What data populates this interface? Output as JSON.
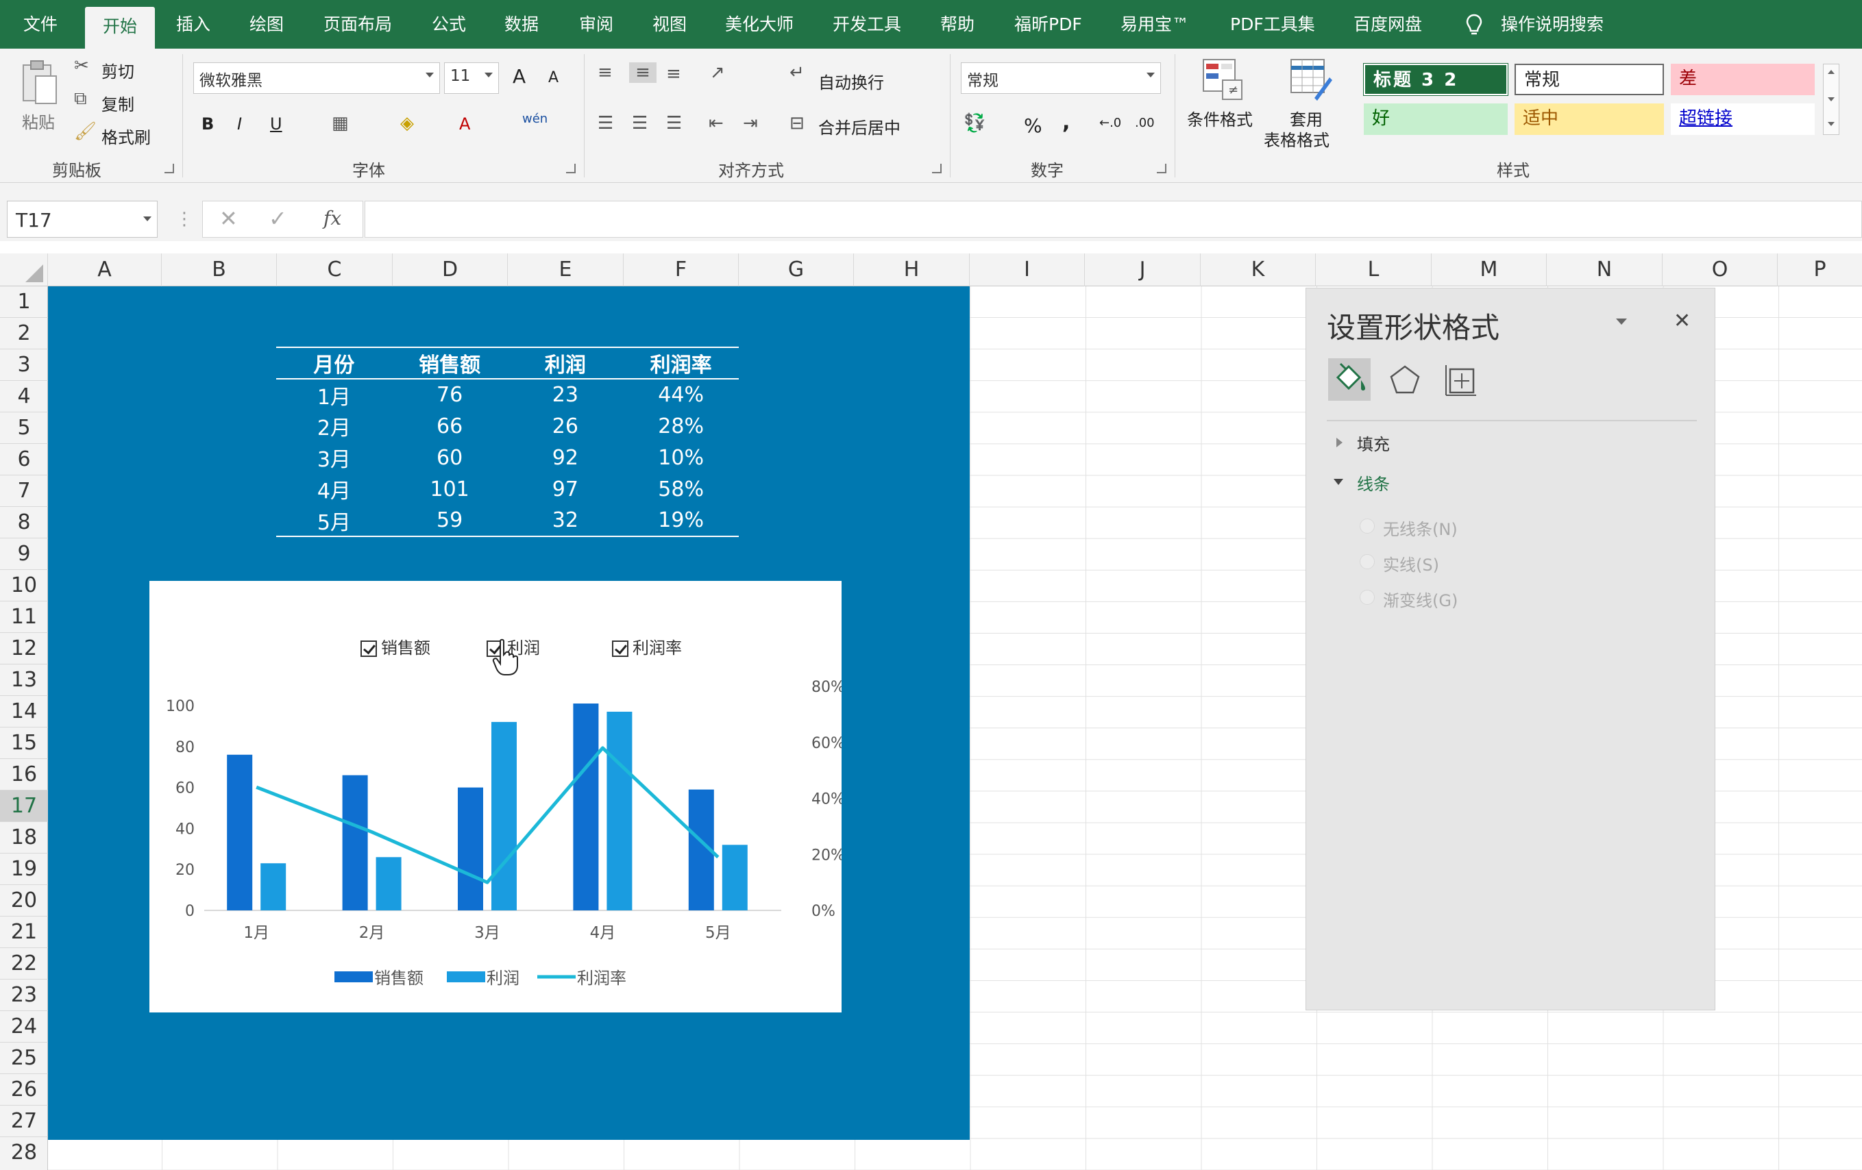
{
  "menu": {
    "tabs": [
      "文件",
      "开始",
      "插入",
      "绘图",
      "页面布局",
      "公式",
      "数据",
      "审阅",
      "视图",
      "美化大师",
      "开发工具",
      "帮助",
      "福昕PDF",
      "易用宝™",
      "PDF工具集",
      "百度网盘"
    ],
    "active_tab": "开始",
    "search": "操作说明搜索"
  },
  "ribbon": {
    "clipboard": {
      "label": "剪贴板",
      "paste": "粘贴",
      "cut": "剪切",
      "copy": "复制",
      "painter": "格式刷"
    },
    "font": {
      "label": "字体",
      "name": "微软雅黑",
      "size": "11",
      "bold": "B",
      "italic": "I",
      "underline": "U",
      "increase": "A",
      "decrease": "A",
      "phonetic": "wén"
    },
    "align": {
      "label": "对齐方式",
      "wrap": "自动换行",
      "merge": "合并后居中"
    },
    "number": {
      "label": "数字",
      "format": "常规",
      "percent": "%",
      "comma": ","
    },
    "styles": {
      "label": "样式",
      "conditional": "条件格式",
      "table_fmt_1": "套用",
      "table_fmt_2": "表格格式",
      "heading": "标题 3 2",
      "normal": "常规",
      "bad": "差",
      "good": "好",
      "neutral": "适中",
      "hyperlink": "超链接"
    }
  },
  "formula_bar": {
    "name_box": "T17",
    "fx": "fx",
    "content": ""
  },
  "columns": [
    "A",
    "B",
    "C",
    "D",
    "E",
    "F",
    "G",
    "H",
    "I",
    "J",
    "K",
    "L",
    "M",
    "N",
    "O",
    "P"
  ],
  "rows": [
    "1",
    "2",
    "3",
    "4",
    "5",
    "6",
    "7",
    "8",
    "9",
    "10",
    "11",
    "12",
    "13",
    "14",
    "15",
    "16",
    "17",
    "18",
    "19",
    "20",
    "21",
    "22",
    "23",
    "24",
    "25",
    "26",
    "27",
    "28"
  ],
  "active_row": "17",
  "table": {
    "headers": [
      "月份",
      "销售额",
      "利润",
      "利润率"
    ],
    "rows": [
      [
        "1月",
        "76",
        "23",
        "44%"
      ],
      [
        "2月",
        "66",
        "26",
        "28%"
      ],
      [
        "3月",
        "60",
        "92",
        "10%"
      ],
      [
        "4月",
        "101",
        "97",
        "58%"
      ],
      [
        "5月",
        "59",
        "32",
        "19%"
      ]
    ]
  },
  "checkboxes": [
    "销售额",
    "利润",
    "利润率"
  ],
  "chart_data": {
    "type": "bar",
    "categories": [
      "1月",
      "2月",
      "3月",
      "4月",
      "5月"
    ],
    "series": [
      {
        "name": "销售额",
        "type": "bar",
        "axis": "left",
        "values": [
          76,
          66,
          60,
          101,
          59
        ],
        "color": "#0f6fd0"
      },
      {
        "name": "利润",
        "type": "bar",
        "axis": "left",
        "values": [
          23,
          26,
          92,
          97,
          32
        ],
        "color": "#1a9ce0"
      },
      {
        "name": "利润率",
        "type": "line",
        "axis": "right",
        "values": [
          0.44,
          0.28,
          0.1,
          0.58,
          0.19
        ],
        "color": "#1cb8d8"
      }
    ],
    "yticks_left": [
      "0",
      "20",
      "40",
      "60",
      "80",
      "100"
    ],
    "ylim_left": [
      0,
      100
    ],
    "yticks_right": [
      "0%",
      "20%",
      "40%",
      "60%",
      "80%"
    ],
    "ylim_right": [
      0,
      0.8
    ],
    "legend_position": "bottom"
  },
  "pane": {
    "title": "设置形状格式",
    "fill": "填充",
    "line": "线条",
    "options": [
      "无线条(N)",
      "实线(S)",
      "渐变线(G)"
    ]
  }
}
